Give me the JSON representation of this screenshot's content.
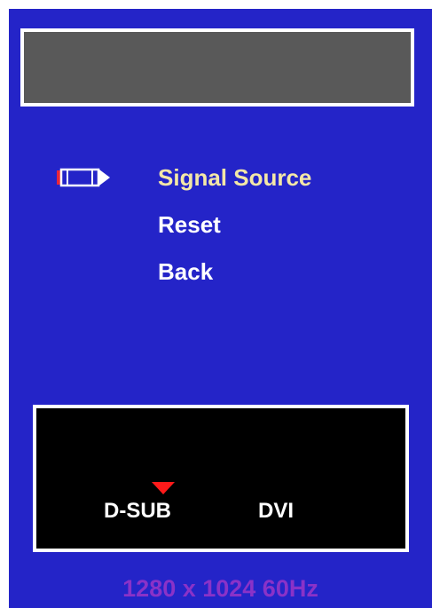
{
  "osd": {
    "title": "",
    "menu_items": [
      {
        "label": "Signal Source",
        "selected": true
      },
      {
        "label": "Reset",
        "selected": false
      },
      {
        "label": "Back",
        "selected": false
      }
    ],
    "source_options": {
      "dsub": "D-SUB",
      "dvi": "DVI",
      "active": "D-SUB"
    },
    "status": {
      "resolution": "1280 x 1024  60Hz"
    }
  },
  "colors": {
    "background": "#2424c8",
    "selected_text": "#f3e7a7",
    "normal_text": "#ffffff",
    "active_marker": "#ff1a1a",
    "status_text": "#8a32c8"
  },
  "icons": {
    "cursor": "pencil-pointer-icon",
    "active_marker": "red-triangle-down-icon"
  }
}
